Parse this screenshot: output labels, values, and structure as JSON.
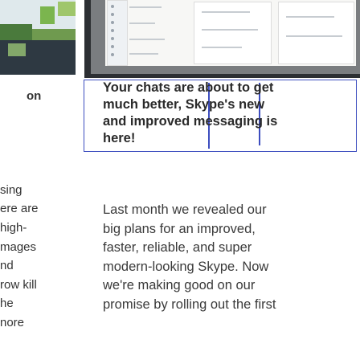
{
  "left_column": {
    "heading_fragment": "on",
    "lines": [
      "sing",
      "ere are",
      "high-",
      "mages",
      "nd",
      "row kill",
      "he",
      "nore"
    ]
  },
  "article": {
    "heading_lines": [
      "Your chats are about to get",
      "much better, Skype's new",
      "and improved messaging is",
      "here!"
    ],
    "body_lines": [
      "Last month we revealed our",
      "big plans for an improved,",
      "faster, reliable, and super",
      "modern-looking Skype. Now",
      "we're making good on our",
      "promise by rolling out the first"
    ]
  },
  "colors": {
    "highlight_border": "#3d4dbf",
    "text": "#3a3a3a"
  }
}
